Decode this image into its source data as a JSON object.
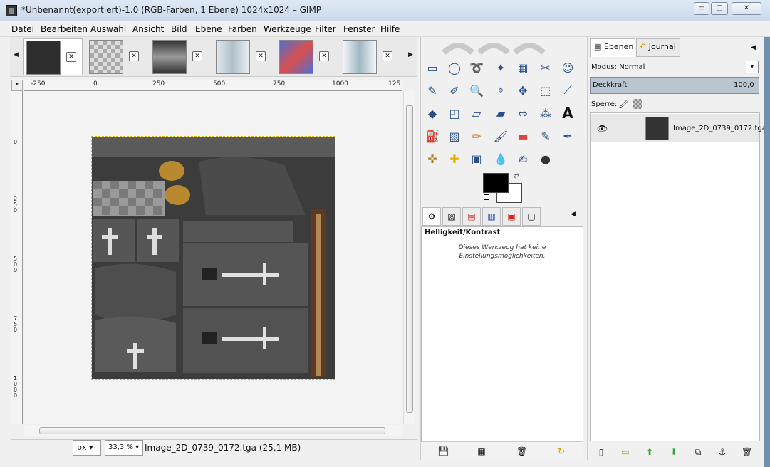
{
  "window": {
    "title": "*Unbenannt(exportiert)-1.0 (RGB-Farben, 1 Ebene) 1024x1024 – GIMP",
    "minimize_glyph": "▭",
    "maximize_glyph": "▢",
    "close_glyph": "✕"
  },
  "menu": [
    "Datei",
    "Bearbeiten",
    "Auswahl",
    "Ansicht",
    "Bild",
    "Ebene",
    "Farben",
    "Werkzeuge",
    "Filter",
    "Fenster",
    "Hilfe"
  ],
  "image_tabs": {
    "left_arrow": "◀",
    "right_arrow": "▶",
    "close_glyph": "✕",
    "items": [
      {
        "thumb": "dark texture",
        "color": "#2e2e2e"
      },
      {
        "thumb": "transparent checker",
        "color": "#bbbbbb"
      },
      {
        "thumb": "gray gradient",
        "color": "#5a5a5a"
      },
      {
        "thumb": "light gray",
        "color": "#c8d4dc"
      },
      {
        "thumb": "blue red",
        "color": "#4d6fd0"
      },
      {
        "thumb": "light blue",
        "color": "#e4eef2"
      }
    ]
  },
  "rulers": {
    "h_labels": [
      "-250",
      "0",
      "250",
      "500",
      "750",
      "1000",
      "125"
    ],
    "v_labels": [
      "0",
      "250",
      "500",
      "750",
      "1000"
    ],
    "corner": "▸"
  },
  "status": {
    "unit": "px",
    "zoom": "33,3 %",
    "info": "Image_2D_0739_0172.tga (25,1 MB)"
  },
  "toolbox": {
    "tools": [
      [
        "▭",
        "◯",
        "➰",
        "✦",
        "▦",
        "✂",
        "☺"
      ],
      [
        "✎",
        "✐",
        "🔍",
        "⌖",
        "✥",
        "⬚",
        "⟋"
      ],
      [
        "◆",
        "◰",
        "▱",
        "▰",
        "⇔",
        "⁂",
        "A"
      ],
      [
        "⛽",
        "▧",
        "✏",
        "🖌",
        "▬",
        "✎",
        "✒"
      ],
      [
        "✜",
        "✚",
        "▣",
        "💧",
        "✍",
        "●"
      ]
    ],
    "fg_color": "#000000",
    "bg_color": "#ffffff"
  },
  "tool_options": {
    "title": "Helligkeit/Kontrast",
    "message": "Dieses Werkzeug hat keine Einstellungsmöglichkeiten.",
    "tabs": [
      "⚙",
      "▨",
      "▤",
      "▥",
      "▣",
      "▢"
    ],
    "footer": [
      "💾",
      "▦",
      "🗑",
      "↻"
    ],
    "menu_arrow": "◀"
  },
  "layers": {
    "tab_ebenen": "Ebenen",
    "tab_journal": "Journal",
    "mode_label": "Modus: Normal",
    "opacity_label": "Deckkraft",
    "opacity_value": "100,0",
    "lock_label": "Sperre:",
    "layer_name": "Image_2D_0739_0172.tga",
    "eye": "👁",
    "dropdown": "▾",
    "footer": [
      "▯",
      "▭",
      "⬆",
      "⬇",
      "⧉",
      "⚓",
      "🗑"
    ],
    "menu_arrow": "◀"
  }
}
